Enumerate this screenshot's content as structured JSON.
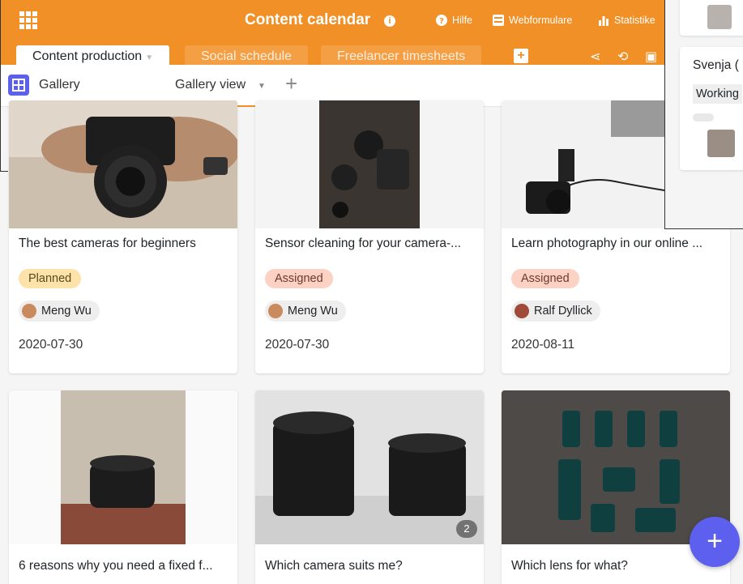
{
  "header": {
    "app_title": "Content calendar",
    "links": [
      {
        "label": "Hilfe",
        "icon": "help-icon"
      },
      {
        "label": "Webformulare",
        "icon": "form-icon"
      },
      {
        "label": "Statistike",
        "icon": "statistics-icon"
      }
    ],
    "accent_color": "#f09026"
  },
  "tabs": [
    {
      "label": "Content production",
      "active": true
    },
    {
      "label": "Social schedule",
      "active": false
    },
    {
      "label": "Freelancer timesheets",
      "active": false
    }
  ],
  "view_bar": {
    "table_label": "Gallery",
    "view_name": "Gallery view"
  },
  "cards": [
    {
      "title": "The best cameras for beginners",
      "status": "Planned",
      "person": "Meng Wu",
      "date": "2020-07-30"
    },
    {
      "title": "Sensor cleaning for your camera-...",
      "status": "Assigned",
      "person": "Meng Wu",
      "date": "2020-07-30"
    },
    {
      "title": "Learn photography in our online ...",
      "status": "Assigned",
      "person": "Ralf Dyllick",
      "date": "2020-08-11"
    },
    {
      "title": "6 reasons why you need a fixed f...",
      "status": "",
      "person": "",
      "date": ""
    },
    {
      "title": "Which camera suits me?",
      "status": "",
      "person": "",
      "date": "",
      "photo_count": "2"
    },
    {
      "title": "Which lens for what?",
      "status": "",
      "person": "",
      "date": ""
    }
  ],
  "side_panel": {
    "name": "Svenja (",
    "status": "Working"
  },
  "fab_label": "+"
}
